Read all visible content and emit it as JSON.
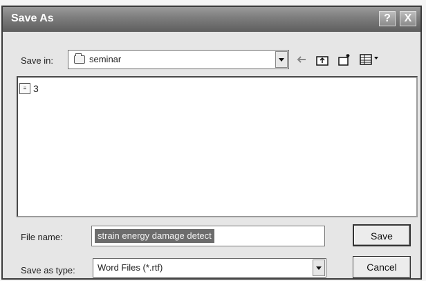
{
  "dialog": {
    "title": "Save As",
    "help_label": "?",
    "close_label": "X"
  },
  "savein": {
    "label": "Save in:",
    "folder": "seminar"
  },
  "files": [
    {
      "name": "3"
    }
  ],
  "filename": {
    "label": "File name:",
    "value": "strain energy damage detect"
  },
  "savetype": {
    "label": "Save as type:",
    "value": "Word Files (*.rtf)"
  },
  "buttons": {
    "save_label": "Save",
    "cancel_label": "Cancel"
  },
  "icons": {
    "back": "back-arrow-icon",
    "up": "up-folder-icon",
    "new": "new-folder-icon",
    "views": "views-menu-icon"
  }
}
